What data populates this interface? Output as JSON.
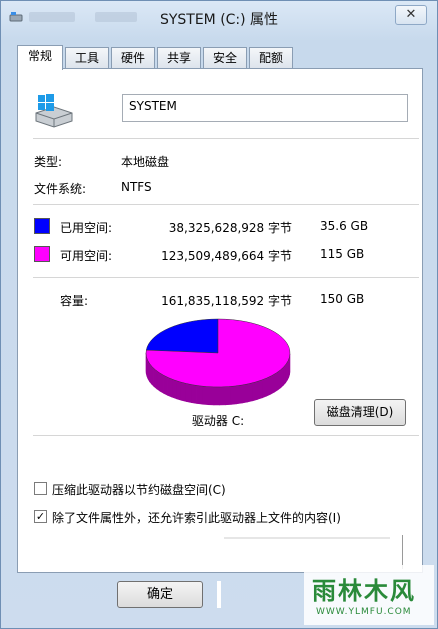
{
  "window": {
    "title": "SYSTEM (C:) 属性",
    "close_label": "✕"
  },
  "tabs": [
    {
      "label": "常规",
      "active": true
    },
    {
      "label": "工具",
      "active": false
    },
    {
      "label": "硬件",
      "active": false
    },
    {
      "label": "共享",
      "active": false
    },
    {
      "label": "安全",
      "active": false
    },
    {
      "label": "配额",
      "active": false
    }
  ],
  "general": {
    "volume_name": "SYSTEM",
    "type_label": "类型:",
    "type_value": "本地磁盘",
    "fs_label": "文件系统:",
    "fs_value": "NTFS",
    "used": {
      "label": "已用空间:",
      "bytes": "38,325,628,928 字节",
      "size": "35.6 GB",
      "color": "#0000ff"
    },
    "free": {
      "label": "可用空间:",
      "bytes": "123,509,489,664 字节",
      "size": "115 GB",
      "color": "#ff00ff"
    },
    "capacity": {
      "label": "容量:",
      "bytes": "161,835,118,592 字节",
      "size": "150 GB"
    },
    "drive_label": "驱动器 C:",
    "cleanup_button": "磁盘清理(D)",
    "compress_checkbox": {
      "label": "压缩此驱动器以节约磁盘空间(C)",
      "checked": false
    },
    "index_checkbox": {
      "label": "除了文件属性外，还允许索引此驱动器上文件的内容(I)",
      "checked": true
    }
  },
  "chart_data": {
    "type": "pie",
    "categories": [
      "已用空间",
      "可用空间"
    ],
    "values": [
      35.6,
      115
    ],
    "colors": [
      "#0000ff",
      "#ff00ff"
    ]
  },
  "footer": {
    "ok_label": "确定"
  },
  "watermark": {
    "text": "雨林木风",
    "url": "WWW.YLMFU.COM"
  }
}
